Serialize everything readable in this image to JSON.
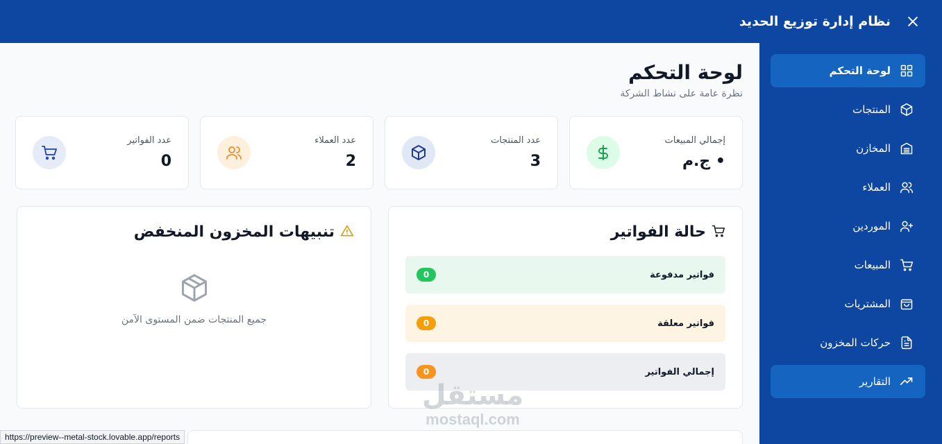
{
  "header": {
    "title": "نظام إدارة توزيع الحديد",
    "close_icon": "close-icon"
  },
  "sidebar": {
    "items": [
      {
        "label": "لوحة التحكم",
        "icon": "dashboard-grid-icon",
        "active": true
      },
      {
        "label": "المنتجات",
        "icon": "package-icon"
      },
      {
        "label": "المخازن",
        "icon": "warehouse-icon"
      },
      {
        "label": "العملاء",
        "icon": "users-icon"
      },
      {
        "label": "الموردين",
        "icon": "user-plus-icon"
      },
      {
        "label": "المبيعات",
        "icon": "cart-icon"
      },
      {
        "label": "المشتريات",
        "icon": "shopping-bag-icon"
      },
      {
        "label": "حركات المخزون",
        "icon": "file-text-icon"
      },
      {
        "label": "التقارير",
        "icon": "trending-up-icon"
      }
    ]
  },
  "main": {
    "title": "لوحة التحكم",
    "subtitle": "نظرة عامة على نشاط الشركة",
    "stats": [
      {
        "label": "إجمالي المبيعات",
        "value": "• ج.م",
        "icon": "dollar-icon",
        "color": "#16a34a",
        "bg": "#dcfce7"
      },
      {
        "label": "عدد المنتجات",
        "value": "3",
        "icon": "package-icon",
        "color": "#1e3a8a",
        "bg": "#e0e7f5"
      },
      {
        "label": "عدد العملاء",
        "value": "2",
        "icon": "users-icon",
        "color": "#ea8c2c",
        "bg": "#fdf0dd"
      },
      {
        "label": "عدد الفواتير",
        "value": "0",
        "icon": "cart-icon",
        "color": "#1e40af",
        "bg": "#e5ecf8"
      }
    ],
    "invoices": {
      "title": "حالة الفواتير",
      "rows": [
        {
          "label": "فواتير مدفوعة",
          "count": "0",
          "bg": "#e8f8ee",
          "badge": "#22c55e"
        },
        {
          "label": "فواتير معلقة",
          "count": "0",
          "bg": "#fdf4e3",
          "badge": "#f59e0b"
        },
        {
          "label": "إجمالي الفواتير",
          "count": "0",
          "bg": "#eceef1",
          "badge": "#f7941d"
        }
      ]
    },
    "low_stock": {
      "title": "تنبيهات المخزون المنخفض",
      "empty_text": "جميع المنتجات ضمن المستوى الآمن"
    }
  },
  "status_bar": {
    "url": "https://preview--metal-stock.lovable.app/reports"
  },
  "watermark": {
    "arabic": "مستقل",
    "latin": "mostaql.com"
  }
}
